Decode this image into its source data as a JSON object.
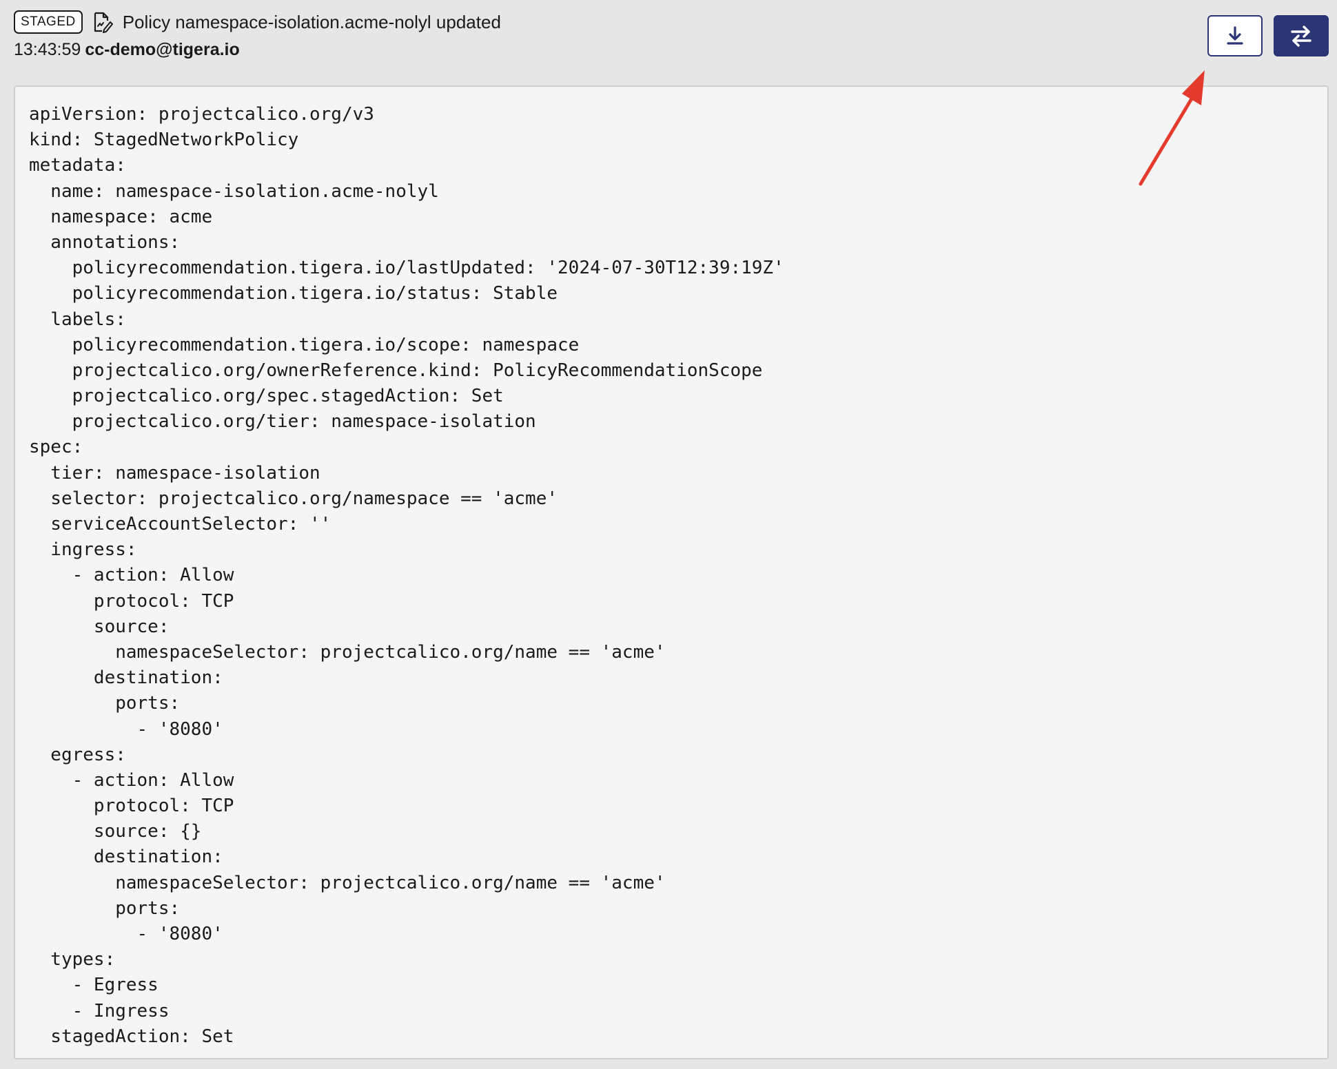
{
  "header": {
    "badge": "STAGED",
    "icon": "edit-document-icon",
    "title": "Policy namespace-isolation.acme-nolyl updated",
    "time": "13:43:59",
    "user": "cc-demo@tigera.io"
  },
  "toolbar": {
    "download_icon": "download-icon",
    "compare_icon": "swap-arrows-icon"
  },
  "colors": {
    "accent": "#2b3576",
    "annotation_arrow": "#e53b2e"
  },
  "code_lines": [
    "apiVersion: projectcalico.org/v3",
    "kind: StagedNetworkPolicy",
    "metadata:",
    "  name: namespace-isolation.acme-nolyl",
    "  namespace: acme",
    "  annotations:",
    "    policyrecommendation.tigera.io/lastUpdated: '2024-07-30T12:39:19Z'",
    "    policyrecommendation.tigera.io/status: Stable",
    "  labels:",
    "    policyrecommendation.tigera.io/scope: namespace",
    "    projectcalico.org/ownerReference.kind: PolicyRecommendationScope",
    "    projectcalico.org/spec.stagedAction: Set",
    "    projectcalico.org/tier: namespace-isolation",
    "spec:",
    "  tier: namespace-isolation",
    "  selector: projectcalico.org/namespace == 'acme'",
    "  serviceAccountSelector: ''",
    "  ingress:",
    "    - action: Allow",
    "      protocol: TCP",
    "      source:",
    "        namespaceSelector: projectcalico.org/name == 'acme'",
    "      destination:",
    "        ports:",
    "          - '8080'",
    "  egress:",
    "    - action: Allow",
    "      protocol: TCP",
    "      source: {}",
    "      destination:",
    "        namespaceSelector: projectcalico.org/name == 'acme'",
    "        ports:",
    "          - '8080'",
    "  types:",
    "    - Egress",
    "    - Ingress",
    "  stagedAction: Set"
  ]
}
